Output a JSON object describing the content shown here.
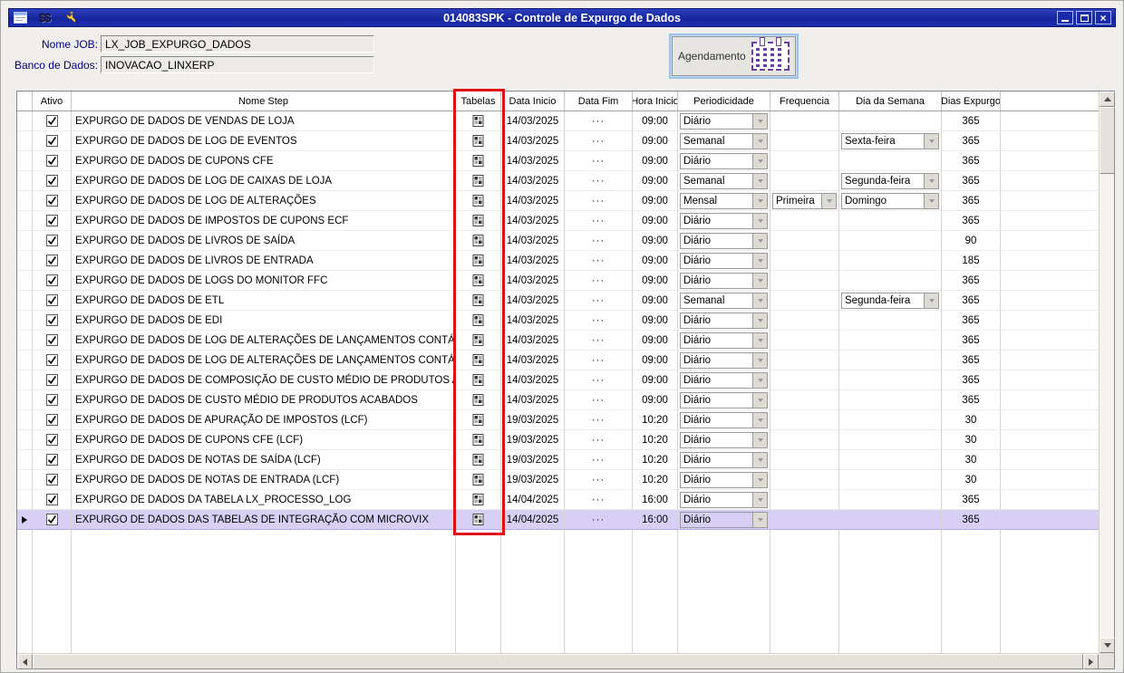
{
  "window": {
    "title": "014083SPK - Controle de Expurgo de Dados"
  },
  "form": {
    "nome_job_label": "Nome JOB:",
    "nome_job_value": "LX_JOB_EXPURGO_DADOS",
    "banco_label": "Banco de Dados:",
    "banco_value": "INOVACAO_LINXERP",
    "agendamento_label": "Agendamento"
  },
  "icons": {
    "titlebar": [
      "window-form-icon",
      "money-icon",
      "wrench-icon"
    ],
    "money_glyph": "$$",
    "window_controls": [
      "minimize-icon",
      "maximize-icon",
      "close-icon"
    ],
    "tabelas_column": "table-grid-icon",
    "agendamento": "calendar-icon",
    "row_indicator": "right-arrow-icon",
    "combo": "chevron-down-icon"
  },
  "colors": {
    "titlebar_blue": "#1c2aa8",
    "label_navy": "#000080",
    "selected_row": "#d7d0f4",
    "annotation_red": "#dd1111",
    "calendar_purple": "#6a3fa0"
  },
  "annotation": {
    "highlighted_column": "Tabelas",
    "shape": "red-rectangle"
  },
  "grid": {
    "columns": [
      "Ativo",
      "Nome Step",
      "Tabelas",
      "Data Inicio",
      "Data Fim",
      "Hora Inicio",
      "Periodicidade",
      "Frequencia",
      "Dia da Semana",
      "Dias Expurgo"
    ],
    "rows": [
      {
        "ativo": true,
        "nome": "EXPURGO DE DADOS DE VENDAS DE LOJA",
        "data_inicio": "14/03/2025",
        "data_fim": "···",
        "hora_inicio": "09:00",
        "periodicidade": "Diário",
        "frequencia": "",
        "dia_da_semana": "",
        "dias_expurgo": "365",
        "selected": false
      },
      {
        "ativo": true,
        "nome": "EXPURGO DE DADOS DE LOG DE EVENTOS",
        "data_inicio": "14/03/2025",
        "data_fim": "···",
        "hora_inicio": "09:00",
        "periodicidade": "Semanal",
        "frequencia": "",
        "dia_da_semana": "Sexta-feira",
        "dias_expurgo": "365",
        "selected": false
      },
      {
        "ativo": true,
        "nome": "EXPURGO DE DADOS DE CUPONS CFE",
        "data_inicio": "14/03/2025",
        "data_fim": "···",
        "hora_inicio": "09:00",
        "periodicidade": "Diário",
        "frequencia": "",
        "dia_da_semana": "",
        "dias_expurgo": "365",
        "selected": false
      },
      {
        "ativo": true,
        "nome": "EXPURGO DE DADOS DE LOG DE CAIXAS DE LOJA",
        "data_inicio": "14/03/2025",
        "data_fim": "···",
        "hora_inicio": "09:00",
        "periodicidade": "Semanal",
        "frequencia": "",
        "dia_da_semana": "Segunda-feira",
        "dias_expurgo": "365",
        "selected": false
      },
      {
        "ativo": true,
        "nome": "EXPURGO DE DADOS DE LOG DE ALTERAÇÕES",
        "data_inicio": "14/03/2025",
        "data_fim": "···",
        "hora_inicio": "09:00",
        "periodicidade": "Mensal",
        "frequencia": "Primeira",
        "dia_da_semana": "Domingo",
        "dias_expurgo": "365",
        "selected": false
      },
      {
        "ativo": true,
        "nome": "EXPURGO DE DADOS DE IMPOSTOS DE CUPONS ECF",
        "data_inicio": "14/03/2025",
        "data_fim": "···",
        "hora_inicio": "09:00",
        "periodicidade": "Diário",
        "frequencia": "",
        "dia_da_semana": "",
        "dias_expurgo": "365",
        "selected": false
      },
      {
        "ativo": true,
        "nome": "EXPURGO DE DADOS DE LIVROS DE SAÍDA",
        "data_inicio": "14/03/2025",
        "data_fim": "···",
        "hora_inicio": "09:00",
        "periodicidade": "Diário",
        "frequencia": "",
        "dia_da_semana": "",
        "dias_expurgo": "90",
        "selected": false
      },
      {
        "ativo": true,
        "nome": "EXPURGO DE DADOS DE LIVROS DE ENTRADA",
        "data_inicio": "14/03/2025",
        "data_fim": "···",
        "hora_inicio": "09:00",
        "periodicidade": "Diário",
        "frequencia": "",
        "dia_da_semana": "",
        "dias_expurgo": "185",
        "selected": false
      },
      {
        "ativo": true,
        "nome": "EXPURGO DE DADOS DE LOGS DO MONITOR FFC",
        "data_inicio": "14/03/2025",
        "data_fim": "···",
        "hora_inicio": "09:00",
        "periodicidade": "Diário",
        "frequencia": "",
        "dia_da_semana": "",
        "dias_expurgo": "365",
        "selected": false
      },
      {
        "ativo": true,
        "nome": "EXPURGO DE DADOS DE ETL",
        "data_inicio": "14/03/2025",
        "data_fim": "···",
        "hora_inicio": "09:00",
        "periodicidade": "Semanal",
        "frequencia": "",
        "dia_da_semana": "Segunda-feira",
        "dias_expurgo": "365",
        "selected": false
      },
      {
        "ativo": true,
        "nome": "EXPURGO DE DADOS DE EDI",
        "data_inicio": "14/03/2025",
        "data_fim": "···",
        "hora_inicio": "09:00",
        "periodicidade": "Diário",
        "frequencia": "",
        "dia_da_semana": "",
        "dias_expurgo": "365",
        "selected": false
      },
      {
        "ativo": true,
        "nome": "EXPURGO DE DADOS DE LOG DE ALTERAÇÕES DE LANÇAMENTOS CONTÁBEIS (CAPAS)",
        "data_inicio": "14/03/2025",
        "data_fim": "···",
        "hora_inicio": "09:00",
        "periodicidade": "Diário",
        "frequencia": "",
        "dia_da_semana": "",
        "dias_expurgo": "365",
        "selected": false
      },
      {
        "ativo": true,
        "nome": "EXPURGO DE DADOS DE LOG DE ALTERAÇÕES DE LANÇAMENTOS CONTÁBEIS (ITENS)",
        "data_inicio": "14/03/2025",
        "data_fim": "···",
        "hora_inicio": "09:00",
        "periodicidade": "Diário",
        "frequencia": "",
        "dia_da_semana": "",
        "dias_expurgo": "365",
        "selected": false
      },
      {
        "ativo": true,
        "nome": "EXPURGO DE DADOS DE COMPOSIÇÃO DE CUSTO MÉDIO DE PRODUTOS ACABADOS",
        "data_inicio": "14/03/2025",
        "data_fim": "···",
        "hora_inicio": "09:00",
        "periodicidade": "Diário",
        "frequencia": "",
        "dia_da_semana": "",
        "dias_expurgo": "365",
        "selected": false
      },
      {
        "ativo": true,
        "nome": "EXPURGO DE DADOS DE CUSTO MÉDIO DE PRODUTOS ACABADOS",
        "data_inicio": "14/03/2025",
        "data_fim": "···",
        "hora_inicio": "09:00",
        "periodicidade": "Diário",
        "frequencia": "",
        "dia_da_semana": "",
        "dias_expurgo": "365",
        "selected": false
      },
      {
        "ativo": true,
        "nome": "EXPURGO DE DADOS DE APURAÇÃO DE IMPOSTOS (LCF)",
        "data_inicio": "19/03/2025",
        "data_fim": "···",
        "hora_inicio": "10:20",
        "periodicidade": "Diário",
        "frequencia": "",
        "dia_da_semana": "",
        "dias_expurgo": "30",
        "selected": false
      },
      {
        "ativo": true,
        "nome": "EXPURGO DE DADOS DE CUPONS CFE (LCF)",
        "data_inicio": "19/03/2025",
        "data_fim": "···",
        "hora_inicio": "10:20",
        "periodicidade": "Diário",
        "frequencia": "",
        "dia_da_semana": "",
        "dias_expurgo": "30",
        "selected": false
      },
      {
        "ativo": true,
        "nome": "EXPURGO DE DADOS DE NOTAS DE SAÍDA (LCF)",
        "data_inicio": "19/03/2025",
        "data_fim": "···",
        "hora_inicio": "10:20",
        "periodicidade": "Diário",
        "frequencia": "",
        "dia_da_semana": "",
        "dias_expurgo": "30",
        "selected": false
      },
      {
        "ativo": true,
        "nome": "EXPURGO DE DADOS DE NOTAS DE ENTRADA (LCF)",
        "data_inicio": "19/03/2025",
        "data_fim": "···",
        "hora_inicio": "10:20",
        "periodicidade": "Diário",
        "frequencia": "",
        "dia_da_semana": "",
        "dias_expurgo": "30",
        "selected": false
      },
      {
        "ativo": true,
        "nome": "EXPURGO DE DADOS DA TABELA LX_PROCESSO_LOG",
        "data_inicio": "14/04/2025",
        "data_fim": "···",
        "hora_inicio": "16:00",
        "periodicidade": "Diário",
        "frequencia": "",
        "dia_da_semana": "",
        "dias_expurgo": "365",
        "selected": false
      },
      {
        "ativo": true,
        "nome": "EXPURGO DE DADOS DAS TABELAS DE INTEGRAÇÃO COM MICROVIX",
        "data_inicio": "14/04/2025",
        "data_fim": "···",
        "hora_inicio": "16:00",
        "periodicidade": "Diário",
        "frequencia": "",
        "dia_da_semana": "",
        "dias_expurgo": "365",
        "selected": true
      }
    ]
  }
}
